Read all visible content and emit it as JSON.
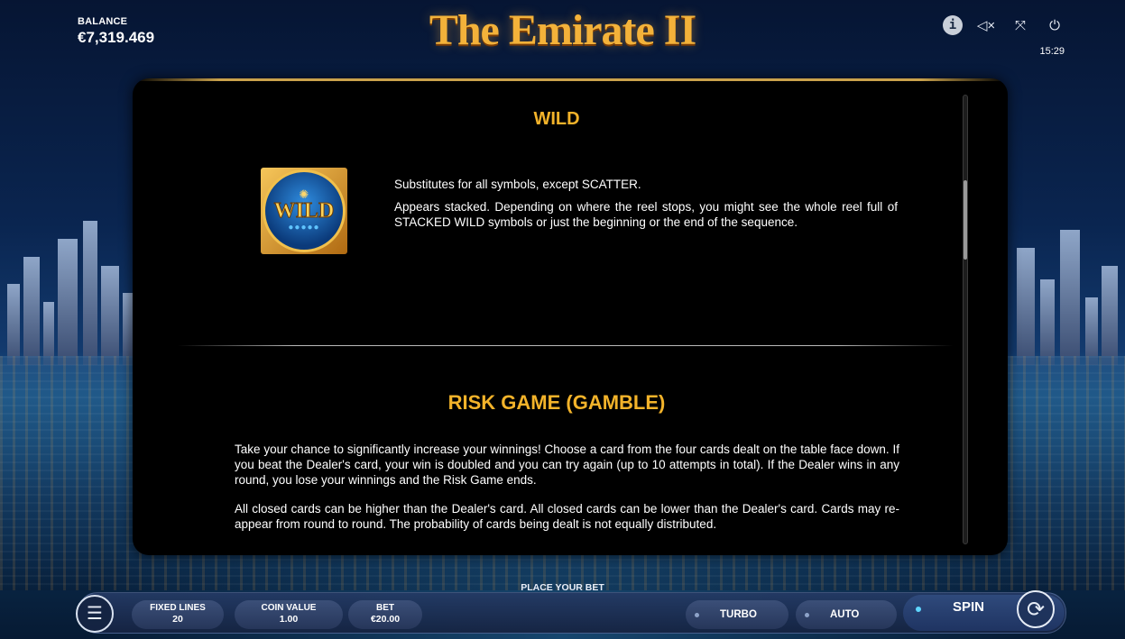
{
  "balance": {
    "label": "BALANCE",
    "value": "€7,319.469"
  },
  "logo": {
    "text": "The Emirate II"
  },
  "top_icons": {
    "info": "i",
    "mute": "◁×",
    "fullscreen": "⤧",
    "power": "⏻"
  },
  "clock": "15:29",
  "panel": {
    "wild": {
      "title": "WILD",
      "symbol_text": "WILD",
      "paragraphs": [
        "Substitutes for all symbols, except SCATTER.",
        "Appears stacked. Depending on where the reel stops, you might see the whole reel full of STACKED WILD symbols or just the beginning or the end of the sequence."
      ]
    },
    "risk": {
      "title": "RISK GAME (GAMBLE)",
      "paragraphs": [
        "Take your chance to significantly increase your winnings! Choose a card from the four cards dealt on the table face down. If you beat the Dealer's card, your win is doubled and you can try again (up to 10 attempts in total). If the Dealer wins in any round, you lose your winnings and the Risk Game ends.",
        "All closed cards can be higher than the Dealer's card. All closed cards can be lower than the Dealer's card. Cards may re-appear from round to round. The probability of cards being dealt is not equally distributed."
      ]
    }
  },
  "bottom": {
    "place_bet": "PLACE YOUR BET",
    "fixed_lines": {
      "label": "FIXED LINES",
      "value": "20"
    },
    "coin_value": {
      "label": "COIN VALUE",
      "value": "1.00"
    },
    "bet": {
      "label": "BET",
      "value": "€20.00"
    },
    "turbo": "TURBO",
    "auto": "AUTO",
    "spin": "SPIN"
  },
  "colors": {
    "accent_gold": "#f3b32a",
    "panel_bg": "#000000"
  }
}
